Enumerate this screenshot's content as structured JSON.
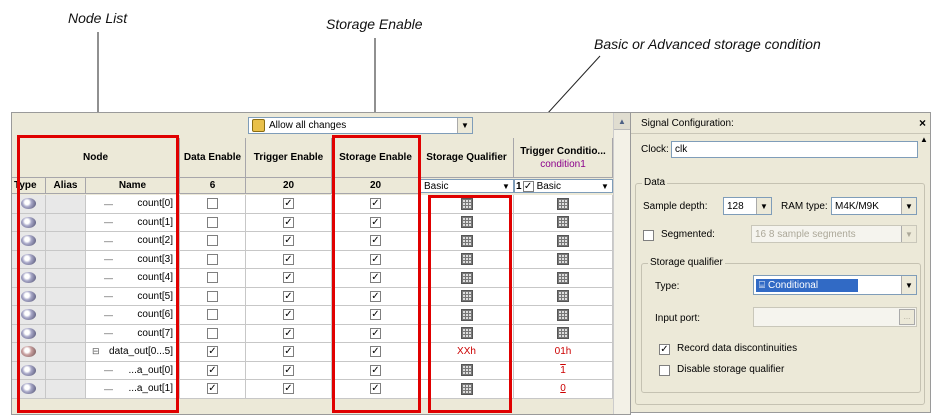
{
  "callouts": {
    "node_list": "Node List",
    "storage_enable": "Storage Enable",
    "storage_condition": "Basic or Advanced storage condition"
  },
  "toolbar": {
    "lock_label": "Allow all changes"
  },
  "table": {
    "headers": {
      "node": "Node",
      "data_enable": "Data Enable",
      "trigger_enable": "Trigger Enable",
      "storage_enable": "Storage Enable",
      "storage_qualifier": "Storage Qualifier",
      "trigger_conditions": "Trigger Conditio...",
      "trigger_condition_sub": "condition1"
    },
    "subheaders": {
      "type": "Type",
      "alias": "Alias",
      "name": "Name",
      "data_enable_count": "6",
      "trigger_enable_count": "20",
      "storage_enable_count": "20",
      "storage_qualifier_mode": "Basic",
      "trigger_condition_index": "1",
      "trigger_condition_mode": "Basic"
    },
    "rows": [
      {
        "name": "count[0]",
        "data": false,
        "trigger": true,
        "storage": true,
        "qual": "grid",
        "cond": "grid"
      },
      {
        "name": "count[1]",
        "data": false,
        "trigger": true,
        "storage": true,
        "qual": "grid",
        "cond": "grid"
      },
      {
        "name": "count[2]",
        "data": false,
        "trigger": true,
        "storage": true,
        "qual": "grid",
        "cond": "grid"
      },
      {
        "name": "count[3]",
        "data": false,
        "trigger": true,
        "storage": true,
        "qual": "grid",
        "cond": "grid"
      },
      {
        "name": "count[4]",
        "data": false,
        "trigger": true,
        "storage": true,
        "qual": "grid",
        "cond": "grid"
      },
      {
        "name": "count[5]",
        "data": false,
        "trigger": true,
        "storage": true,
        "qual": "grid",
        "cond": "grid"
      },
      {
        "name": "count[6]",
        "data": false,
        "trigger": true,
        "storage": true,
        "qual": "grid",
        "cond": "grid"
      },
      {
        "name": "count[7]",
        "data": false,
        "trigger": true,
        "storage": true,
        "qual": "grid",
        "cond": "grid"
      },
      {
        "name": "data_out[0...5]",
        "data": true,
        "trigger": true,
        "storage": true,
        "qual": "XXh",
        "cond": "01h",
        "bus": true
      },
      {
        "name": "...a_out[0]",
        "data": true,
        "trigger": true,
        "storage": true,
        "qual": "grid",
        "cond": "1"
      },
      {
        "name": "...a_out[1]",
        "data": true,
        "trigger": true,
        "storage": true,
        "qual": "grid",
        "cond": "0"
      }
    ]
  },
  "side": {
    "title": "Signal Configuration:",
    "close": "×",
    "clock_label": "Clock:",
    "clock_value": "clk",
    "data_group": "Data",
    "sample_depth_label": "Sample depth:",
    "sample_depth_value": "128",
    "ram_type_label": "RAM type:",
    "ram_type_value": "M4K/M9K",
    "segmented_label": "Segmented:",
    "segmented_value": "16  8 sample segments",
    "storage_qualifier_group": "Storage qualifier",
    "type_label": "Type:",
    "type_value": "Conditional",
    "input_port_label": "Input port:",
    "record_label": "Record data discontinuities",
    "disable_label": "Disable storage qualifier"
  },
  "colors": {
    "highlight": "#e00000",
    "value_text": "#cc0000",
    "selection": "#316ac5"
  }
}
